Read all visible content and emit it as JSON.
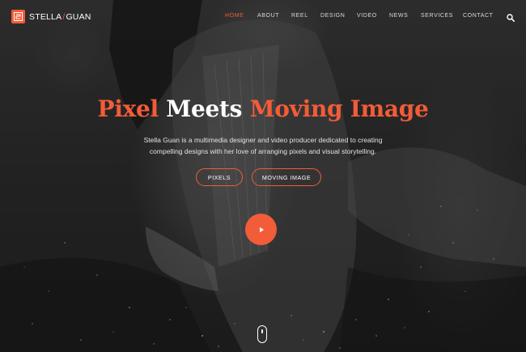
{
  "brand": {
    "name_first": "STELLA",
    "slash": "/",
    "name_second": "GUAN",
    "accent_color": "#f25c38"
  },
  "nav": {
    "items": [
      {
        "label": "HOME",
        "active": true
      },
      {
        "label": "ABOUT",
        "active": false
      },
      {
        "label": "REEL",
        "active": false
      },
      {
        "label": "DESIGN",
        "active": false
      },
      {
        "label": "VIDEO",
        "active": false
      },
      {
        "label": "NEWS",
        "active": false
      },
      {
        "label": "SERVICES",
        "active": false
      },
      {
        "label": "CONTACT",
        "active": false
      }
    ],
    "search_icon": "search-icon"
  },
  "hero": {
    "headline_part1": "Pixel",
    "headline_part2": "Meets",
    "headline_part3": "Moving Image",
    "subtitle": "Stella Guan is a multimedia designer and video producer dedicated to creating compelling designs with her love of arranging pixels and visual storytelling.",
    "buttons": {
      "pixels": "PIXELS",
      "moving_image": "MOVING IMAGE"
    },
    "play_icon": "play-icon",
    "scroll_icon": "scroll-mouse-icon"
  }
}
